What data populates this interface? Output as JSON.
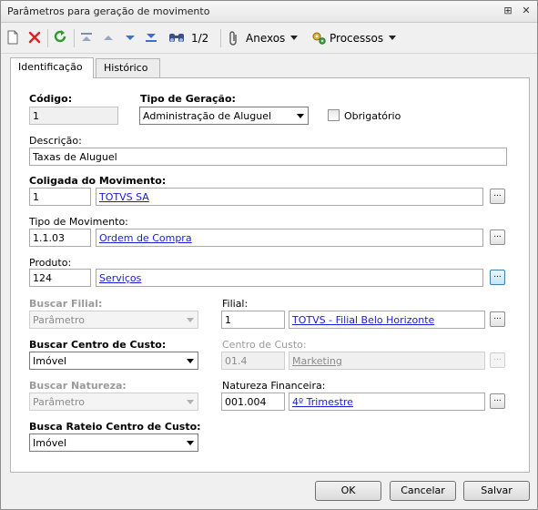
{
  "window": {
    "title": "Parâmetros para geração de movimento",
    "controls": {
      "pin": "⊞",
      "close": "✕"
    }
  },
  "toolbar": {
    "record_position": "1/2",
    "anexos_label": "Anexos",
    "processos_label": "Processos"
  },
  "tabs": [
    "Identificação",
    "Histórico"
  ],
  "form": {
    "codigo": {
      "label": "Código:",
      "value": "1"
    },
    "tipo_geracao": {
      "label": "Tipo de Geração:",
      "value": "Administração de Aluguel"
    },
    "obrigatorio": {
      "label": "Obrigatório",
      "checked": false
    },
    "descricao": {
      "label": "Descrição:",
      "value": "Taxas de Aluguel"
    },
    "coligada": {
      "label": "Coligada do Movimento:",
      "code": "1",
      "name": "TOTVS SA"
    },
    "tipo_movimento": {
      "label": "Tipo de Movimento:",
      "code": "1.1.03",
      "name": "Ordem de Compra"
    },
    "produto": {
      "label": "Produto:",
      "code": "124",
      "name": "Serviços"
    },
    "buscar_filial": {
      "label": "Buscar Filial:",
      "value": "Parâmetro"
    },
    "filial": {
      "label": "Filial:",
      "code": "1",
      "name": "TOTVS - Filial Belo Horizonte"
    },
    "buscar_centro_custo": {
      "label": "Buscar Centro de Custo:",
      "value": "Imóvel"
    },
    "centro_custo": {
      "label": "Centro de Custo:",
      "code": "01.4",
      "name": "Marketing"
    },
    "buscar_natureza": {
      "label": "Buscar Natureza:",
      "value": "Parâmetro"
    },
    "natureza_financeira": {
      "label": "Natureza Financeira:",
      "code": "001.004",
      "name": "4º Trimestre"
    },
    "busca_rateio": {
      "label": "Busca Rateio Centro de Custo:",
      "value": "Imóvel"
    },
    "lookup_button_label": "..."
  },
  "buttons": {
    "ok": "OK",
    "cancel": "Cancelar",
    "save": "Salvar"
  },
  "colors": {
    "link": "#1a1ad6",
    "focus_border": "#3c7fb1",
    "delete_red": "#e02020",
    "refresh_green": "#2c9a2c",
    "nav_blue": "#3a6fd0"
  }
}
